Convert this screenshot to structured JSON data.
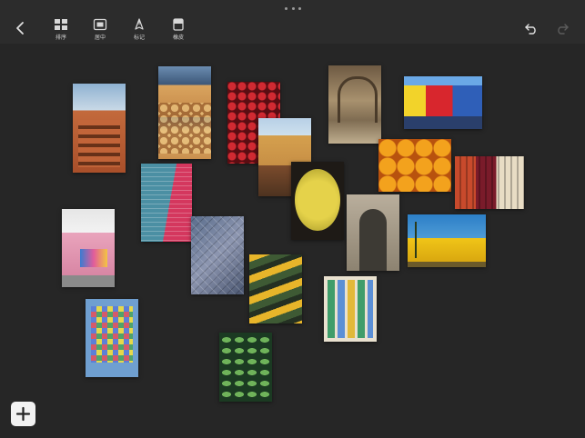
{
  "toolbar": {
    "tools": [
      {
        "label": "排序",
        "icon": "grid-icon"
      },
      {
        "label": "居中",
        "icon": "center-frame-icon"
      },
      {
        "label": "标记",
        "icon": "pen-icon"
      },
      {
        "label": "橡皮",
        "icon": "eraser-icon"
      }
    ]
  },
  "colors": {
    "background": "#262626",
    "toolbar": "#2c2c2c",
    "icon": "#e0e0e0"
  }
}
